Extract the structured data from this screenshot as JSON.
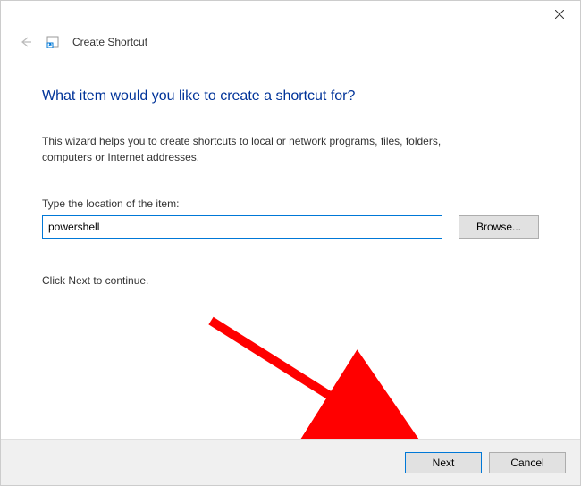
{
  "header": {
    "title": "Create Shortcut"
  },
  "content": {
    "heading": "What item would you like to create a shortcut for?",
    "description": "This wizard helps you to create shortcuts to local or network programs, files, folders, computers or Internet addresses.",
    "field_label": "Type the location of the item:",
    "location_value": "powershell",
    "browse_label": "Browse...",
    "continue_text": "Click Next to continue."
  },
  "footer": {
    "next_label": "Next",
    "cancel_label": "Cancel"
  }
}
